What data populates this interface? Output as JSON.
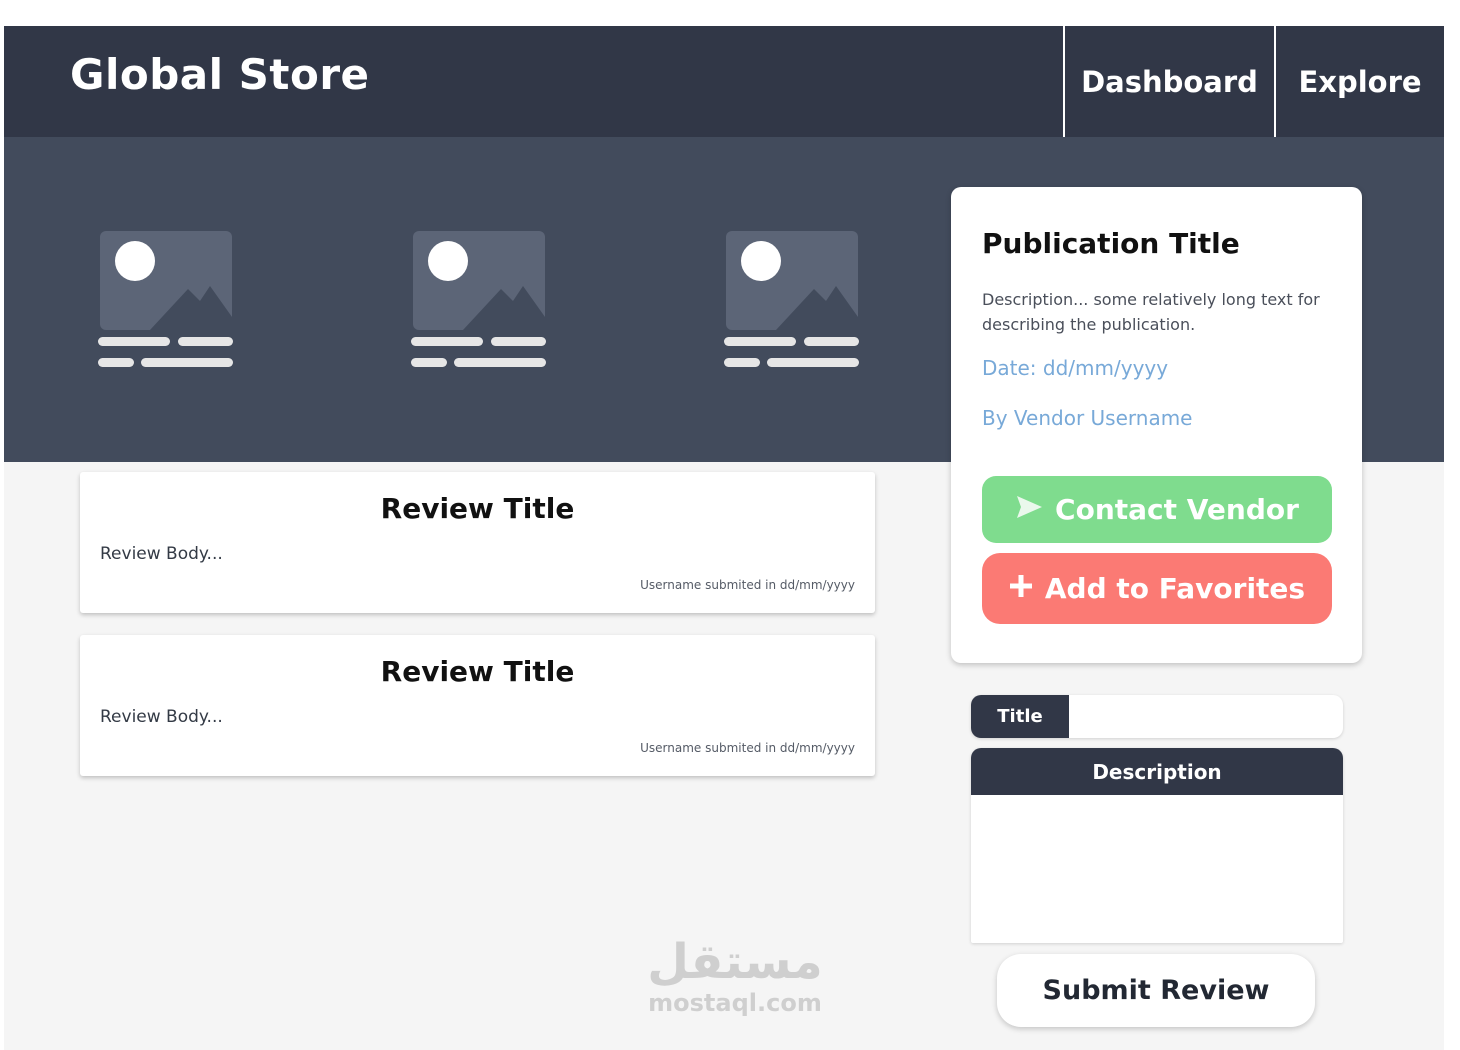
{
  "header": {
    "brand": "Global Store",
    "nav": [
      {
        "label": "Dashboard"
      },
      {
        "label": "Explore"
      }
    ]
  },
  "hero": {
    "thumbnails": [
      {
        "icon": "image-placeholder-icon"
      },
      {
        "icon": "image-placeholder-icon"
      },
      {
        "icon": "image-placeholder-icon"
      }
    ]
  },
  "publication": {
    "title": "Publication Title",
    "description": "Description... some relatively long text for describing the publication.",
    "date": "Date: dd/mm/yyyy",
    "vendor": "By Vendor Username",
    "contact_label": "Contact Vendor",
    "contact_icon": "send-icon",
    "favorite_label": "Add to Favorites",
    "favorite_icon": "plus-icon"
  },
  "reviews": [
    {
      "title": "Review Title",
      "body": "Review Body...",
      "meta": "Username submited in dd/mm/yyyy"
    },
    {
      "title": "Review Title",
      "body": "Review Body...",
      "meta": "Username submited in dd/mm/yyyy"
    }
  ],
  "review_form": {
    "title_label": "Title",
    "title_value": "",
    "description_label": "Description",
    "description_value": "",
    "submit_label": "Submit Review"
  },
  "watermark": {
    "arabic": "مستقل",
    "latin": "mostaql.com"
  },
  "colors": {
    "topbar": "#313747",
    "hero": "#424b5c",
    "page_bg": "#f5f5f5",
    "link": "#78a9d8",
    "contact_button": "#7fdc8e",
    "favorite_button": "#fb7a74"
  }
}
